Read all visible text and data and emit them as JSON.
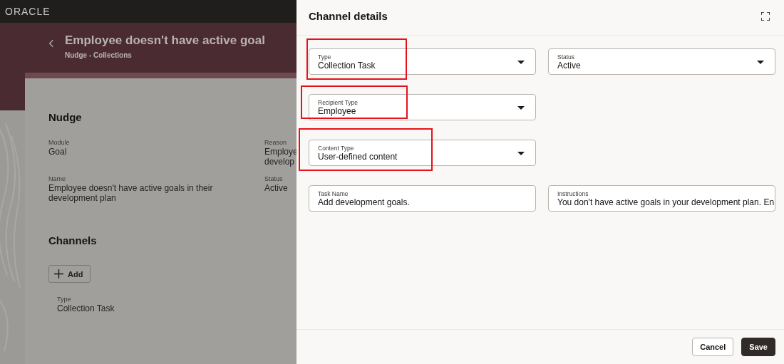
{
  "header": {
    "logo": "ORACLE"
  },
  "page": {
    "title": "Employee doesn't have active goal",
    "subtitle": "Nudge - Collections"
  },
  "nudge": {
    "heading": "Nudge",
    "fields": [
      {
        "label": "Module",
        "value": "Goal"
      },
      {
        "label": "Reason",
        "value": "Employe develop"
      },
      {
        "label": "Name",
        "value": "Employee doesn't have active goals in their development plan"
      },
      {
        "label": "Status",
        "value": "Active"
      }
    ]
  },
  "channels": {
    "heading": "Channels",
    "add_button": "Add",
    "items": [
      {
        "label": "Type",
        "value": "Collection Task"
      }
    ]
  },
  "drawer": {
    "title": "Channel details",
    "fields": [
      {
        "kind": "select",
        "label": "Type",
        "value": "Collection Task",
        "highlighted": true
      },
      {
        "kind": "select",
        "label": "Status",
        "value": "Active",
        "highlighted": false
      },
      {
        "kind": "select",
        "label": "Recipient Type",
        "value": "Employee",
        "highlighted": true
      },
      {
        "kind": "select",
        "label": "Content Type",
        "value": "User-defined content",
        "highlighted": true
      },
      {
        "kind": "text",
        "label": "Task Name",
        "value": "Add development goals.",
        "highlighted": false
      },
      {
        "kind": "text",
        "label": "Instructions",
        "value": "You don't have active goals in your development plan. En",
        "highlighted": false
      }
    ],
    "buttons": [
      {
        "kind": "secondary",
        "label": "Cancel"
      },
      {
        "kind": "primary",
        "label": "Save"
      }
    ]
  }
}
